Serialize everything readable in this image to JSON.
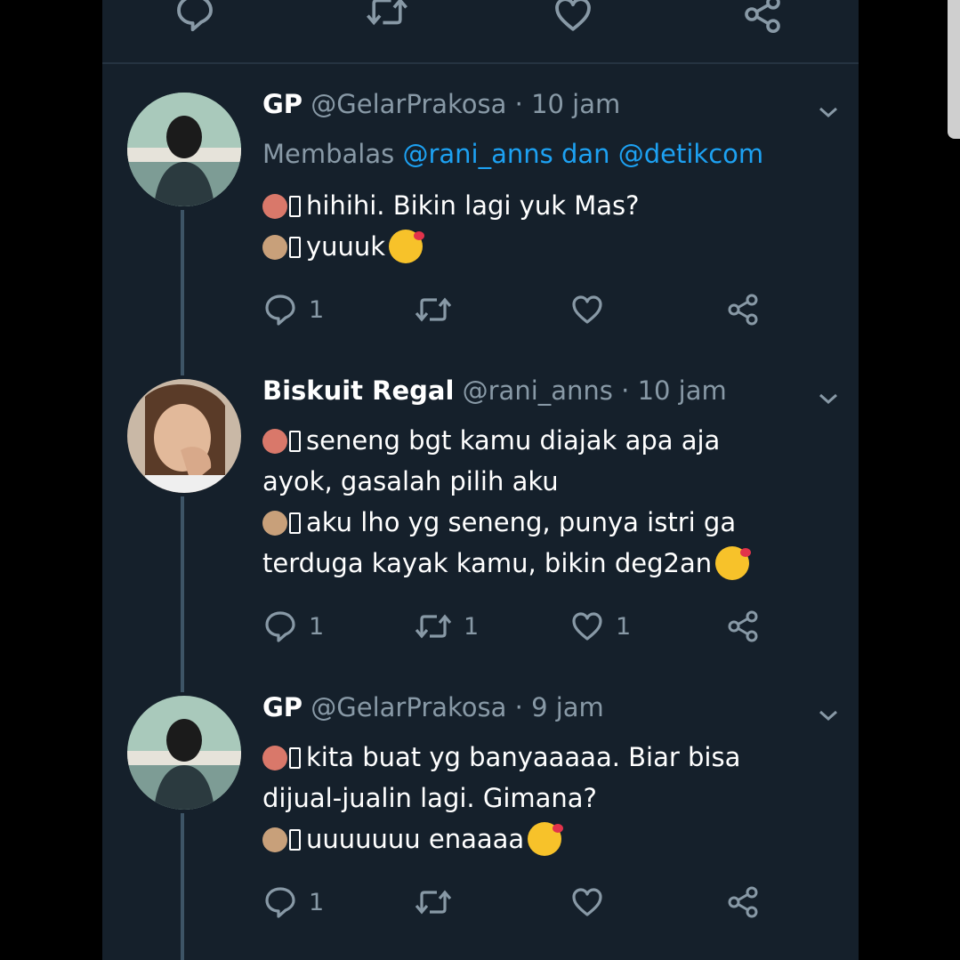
{
  "tweets": [
    {
      "name": "GP",
      "handle": "@GelarPrakosa",
      "sep": "·",
      "time": "10 jam",
      "reply_prefix": "Membalas",
      "reply_mentions": "@rani_anns dan @detikcom",
      "line1": "hihihi. Bikin lagi yuk Mas?",
      "line2": "yuuuk",
      "reply_count": "1",
      "retweet_count": "",
      "like_count": ""
    },
    {
      "name": "Biskuit Regal",
      "handle": "@rani_anns",
      "sep": "·",
      "time": "10 jam",
      "line1a": "seneng bgt kamu diajak apa aja",
      "line1b": "ayok, gasalah pilih aku",
      "line2a": "aku lho yg seneng, punya istri ga",
      "line2b": "terduga kayak kamu, bikin deg2an",
      "reply_count": "1",
      "retweet_count": "1",
      "like_count": "1"
    },
    {
      "name": "GP",
      "handle": "@GelarPrakosa",
      "sep": "·",
      "time": "9 jam",
      "line1a": "kita buat yg banyaaaaa. Biar bisa",
      "line1b": "dijual-jualin lagi. Gimana?",
      "line2": "uuuuuuu enaaaa",
      "reply_count": "1",
      "retweet_count": "",
      "like_count": ""
    }
  ],
  "icons": {
    "reply": "reply-icon",
    "retweet": "retweet-icon",
    "like": "heart-icon",
    "share": "share-icon",
    "caret": "chevron-down-icon"
  },
  "colors": {
    "background": "#15202b",
    "mention": "#1da1f2",
    "muted": "#8899a6"
  }
}
